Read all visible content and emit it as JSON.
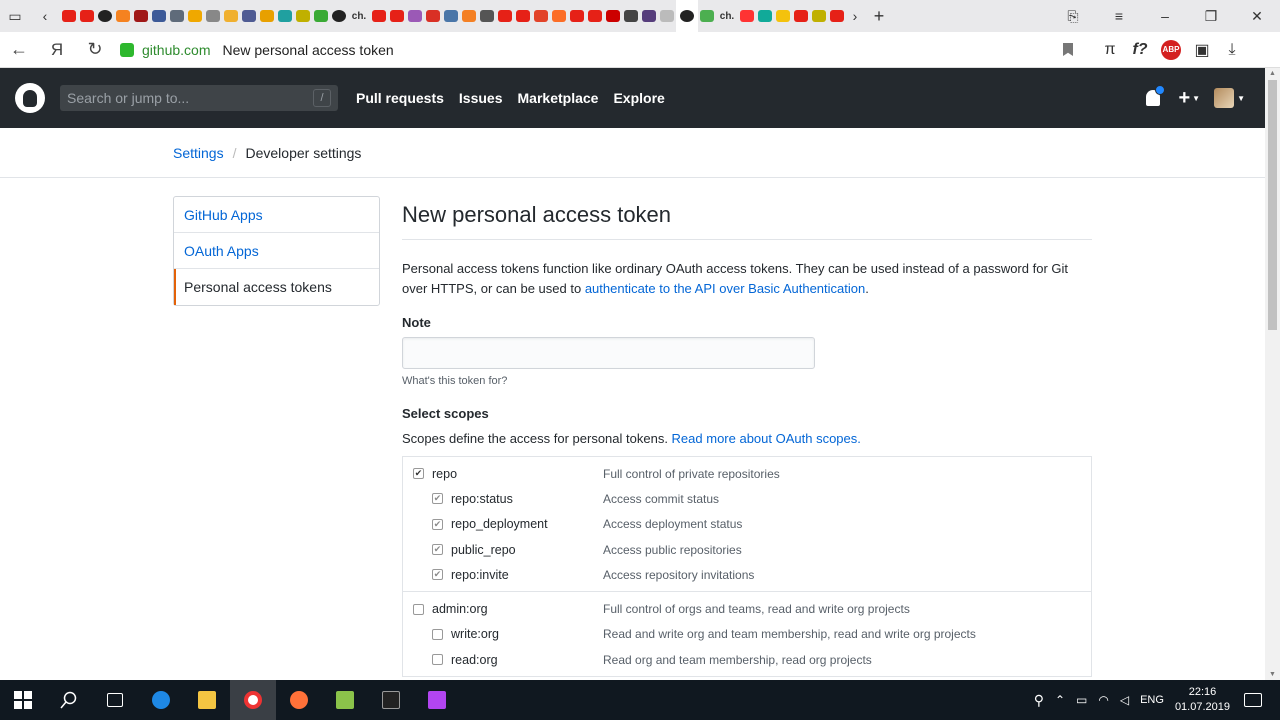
{
  "browser": {
    "url_host": "github.com",
    "url_title": "New personal access token",
    "tab_marker": "ch.",
    "abp_label": "ABP",
    "ext_f": "f?"
  },
  "header": {
    "search_placeholder": "Search or jump to...",
    "search_shortcut": "/",
    "nav": [
      "Pull requests",
      "Issues",
      "Marketplace",
      "Explore"
    ]
  },
  "breadcrumb": {
    "settings": "Settings",
    "separator": "/",
    "current": "Developer settings"
  },
  "menu": [
    "GitHub Apps",
    "OAuth Apps",
    "Personal access tokens"
  ],
  "main": {
    "title": "New personal access token",
    "desc_text": "Personal access tokens function like ordinary OAuth access tokens. They can be used instead of a password for Git over HTTPS, or can be used to ",
    "desc_link": "authenticate to the API over Basic Authentication",
    "desc_end": ".",
    "note_label": "Note",
    "note_hint": "What's this token for?",
    "scopes_label": "Select scopes",
    "scopes_desc": "Scopes define the access for personal tokens. ",
    "scopes_link": "Read more about OAuth scopes."
  },
  "scopes": {
    "repo": {
      "name": "repo",
      "desc": "Full control of private repositories",
      "checked": true
    },
    "repo_sub": [
      {
        "name": "repo:status",
        "desc": "Access commit status"
      },
      {
        "name": "repo_deployment",
        "desc": "Access deployment status"
      },
      {
        "name": "public_repo",
        "desc": "Access public repositories"
      },
      {
        "name": "repo:invite",
        "desc": "Access repository invitations"
      }
    ],
    "admin_org": {
      "name": "admin:org",
      "desc": "Full control of orgs and teams, read and write org projects",
      "checked": false
    },
    "admin_org_sub": [
      {
        "name": "write:org",
        "desc": "Read and write org and team membership, read and write org projects"
      },
      {
        "name": "read:org",
        "desc": "Read org and team membership, read org projects"
      }
    ]
  },
  "taskbar": {
    "lang": "ENG",
    "time": "22:16",
    "date": "01.07.2019"
  }
}
